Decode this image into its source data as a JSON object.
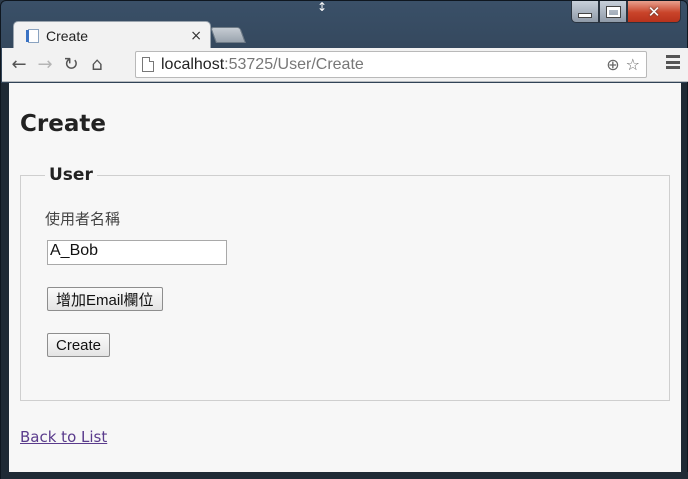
{
  "browser": {
    "tab": {
      "title": "Create",
      "close_glyph": "×"
    },
    "address": {
      "host": "localhost",
      "rest": ":53725/User/Create"
    },
    "nav": {
      "back_icon": "back-arrow-icon",
      "forward_icon": "forward-arrow-icon",
      "reload_icon": "reload-icon",
      "home_icon": "home-icon"
    }
  },
  "page": {
    "title": "Create",
    "fieldset": {
      "legend": "User",
      "username_label": "使用者名稱",
      "username_value": "A_Bob",
      "add_email_button": "增加Email欄位",
      "create_button": "Create"
    },
    "back_link": "Back to List"
  },
  "colors": {
    "link_visited": "#5a3b8c",
    "close_button": "#c9442a"
  }
}
